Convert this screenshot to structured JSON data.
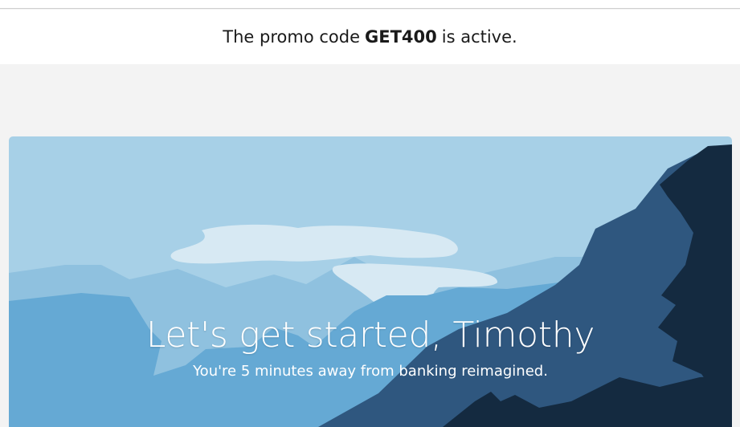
{
  "promo": {
    "prefix": "The promo code",
    "code": "GET400",
    "suffix": "is active."
  },
  "hero": {
    "headline": "Let's get started, Timothy",
    "subheadline": "You're 5 minutes away from banking reimagined.",
    "sky_color": "#a7d0e7",
    "mountain_colors": [
      "#8fc1df",
      "#65a9d4",
      "#2f577f",
      "#142a40"
    ]
  }
}
